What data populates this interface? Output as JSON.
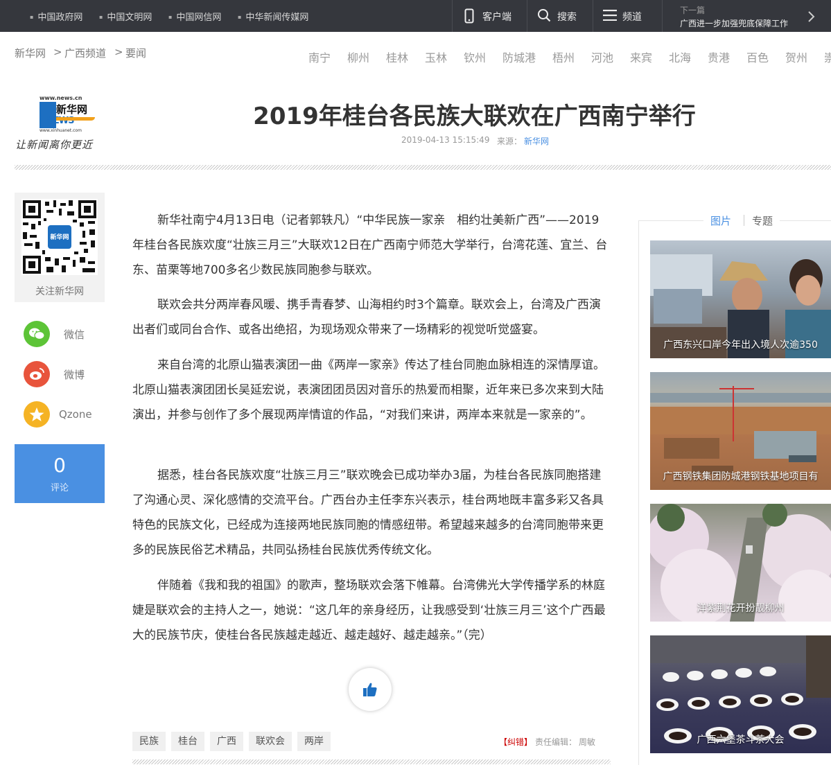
{
  "topbar": {
    "links": [
      "中国政府网",
      "中国文明网",
      "中国网信网",
      "中华新闻传媒网"
    ],
    "client_label": "客户端",
    "search_label": "搜索",
    "channel_label": "频道",
    "next_label": "下一篇",
    "next_title": "广西进一步加强兜底保障工作"
  },
  "breadcrumb": {
    "items": [
      "新华网",
      "广西频道",
      "要闻"
    ],
    "separator": ">"
  },
  "cities": [
    "南宁",
    "柳州",
    "桂林",
    "玉林",
    "钦州",
    "防城港",
    "梧州",
    "河池",
    "来宾",
    "北海",
    "贵港",
    "百色",
    "贺州",
    "崇"
  ],
  "logo": {
    "url_top": "www.news.cn",
    "brand": "新华网",
    "news_letters": "NEWS",
    "url_bottom": "www.xinhuanet.com",
    "slogan": "让新闻离你更近"
  },
  "article": {
    "title": "2019年桂台各民族大联欢在广西南宁举行",
    "datetime": "2019-04-13 15:15:49",
    "source_label": "来源：",
    "source": "新华网",
    "paragraphs": [
      "新华社南宁4月13日电（记者郭轶凡）“中华民族一家亲　相约壮美新广西”——2019年桂台各民族欢度“壮族三月三”大联欢12日在广西南宁师范大学举行，台湾花莲、宜兰、台东、苗栗等地700多名少数民族同胞参与联欢。",
      "联欢会共分两岸春风暖、携手青春梦、山海相约时3个篇章。联欢会上，台湾及广西演出者们或同台合作、或各出绝招，为现场观众带来了一场精彩的视觉听觉盛宴。",
      "来自台湾的北原山猫表演团一曲《两岸一家亲》传达了桂台同胞血脉相连的深情厚谊。北原山猫表演团团长吴延宏说，表演团团员因对音乐的热爱而相聚，近年来已多次来到大陆演出，并参与创作了多个展现两岸情谊的作品，“对我们来讲，两岸本来就是一家亲的”。",
      "据悉，桂台各民族欢度“壮族三月三”联欢晚会已成功举办3届，为桂台各民族同胞搭建了沟通心灵、深化感情的交流平台。广西台办主任李东兴表示，桂台两地既丰富多彩又各具特色的民族文化，已经成为连接两地民族同胞的情感纽带。希望越来越多的台湾同胞带来更多的民族民俗艺术精品，共同弘扬桂台民族优秀传统文化。",
      "伴随着《我和我的祖国》的歌声，整场联欢会落下帷幕。台湾佛光大学传播学系的林庭婕是联欢会的主持人之一，她说：“这几年的亲身经历，让我感受到‘壮族三月三’这个广西最大的民族节庆，使桂台各民族越走越近、越走越好、越走越亲。”（完）"
    ],
    "tags": [
      "民族",
      "桂台",
      "广西",
      "联欢会",
      "两岸"
    ],
    "correction_label": "【纠错】",
    "editor_label": "责任编辑：",
    "editor": "周敏"
  },
  "share": {
    "qr_caption": "关注新华网",
    "qr_center": "新华网",
    "wechat": "微信",
    "weibo": "微博",
    "qzone": "Qzone",
    "comment_count": "0",
    "comment_label": "评论"
  },
  "sidebar": {
    "tabs": [
      "图片",
      "专题"
    ],
    "photos": [
      {
        "caption": "广西东兴口岸今年出入境人次逾350"
      },
      {
        "caption": "广西钢铁集团防城港钢铁基地项目有"
      },
      {
        "caption": "洋紫荆花开扮靓柳州"
      },
      {
        "caption": "广西六堡茶斗茶大会"
      }
    ]
  },
  "colors": {
    "topbar_bg": "#35373d",
    "link_blue": "#4a90e2",
    "comment_bg": "#4a90e2",
    "wechat": "#5dc437",
    "weibo": "#e8543c",
    "qzone": "#f5b324",
    "correction_red": "#c00"
  }
}
